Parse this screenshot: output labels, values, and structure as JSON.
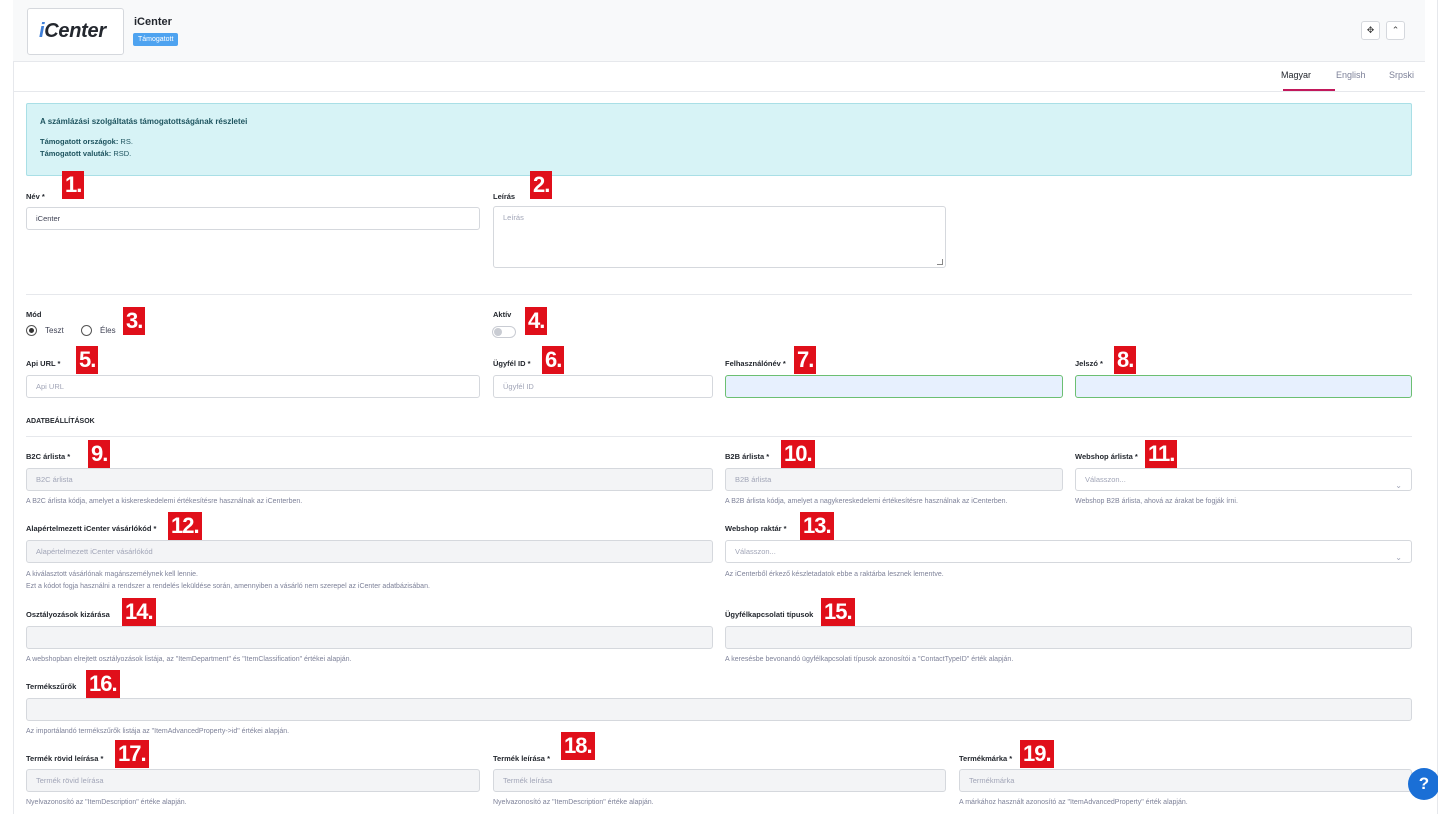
{
  "header": {
    "logo_prefix": "i",
    "logo_rest": "Center",
    "title": "iCenter",
    "badge": "Támogatott"
  },
  "header_buttons": {
    "expand_icon": "arrows-icon",
    "collapse_icon": "chevron-up-icon"
  },
  "tabs": [
    {
      "label": "Magyar",
      "active": true
    },
    {
      "label": "English"
    },
    {
      "label": "Srpski"
    }
  ],
  "info": {
    "title": "A számlázási szolgáltatás támogatottságának részletei",
    "countries_label": "Támogatott országok:",
    "countries_value": " RS.",
    "currencies_label": "Támogatott valuták:",
    "currencies_value": " RSD."
  },
  "fields": {
    "nev": {
      "label": "Név *",
      "value": "iCenter"
    },
    "leiras": {
      "label": "Leírás",
      "placeholder": "Leírás"
    },
    "mod": {
      "label": "Mód",
      "option1": "Teszt",
      "option2": "Éles",
      "selected": "Teszt"
    },
    "aktiv": {
      "label": "Aktív",
      "on": false
    },
    "api_url": {
      "label": "Api URL *",
      "placeholder": "Api URL"
    },
    "ugyfel_id": {
      "label": "Ügyfél ID *",
      "placeholder": "Ügyfél ID"
    },
    "felhasznalonev": {
      "label": "Felhasználónév *"
    },
    "jelszo": {
      "label": "Jelszó *"
    },
    "section": "ADATBEÁLLÍTÁSOK",
    "b2c": {
      "label": "B2C árlista *",
      "placeholder": "B2C árlista",
      "help": "A B2C árlista kódja, amelyet a kiskereskedelemi értékesítésre használnak az iCenterben."
    },
    "b2b": {
      "label": "B2B árlista *",
      "placeholder": "B2B árlista",
      "help": "A B2B árlista kódja, amelyet a nagykereskedelemi értékesítésre használnak az iCenterben."
    },
    "webshop_arlista": {
      "label": "Webshop árlista *",
      "placeholder": "Válasszon...",
      "help": "Webshop B2B árlista, ahová az árakat be fogják írni."
    },
    "alap_vasarlo": {
      "label": "Alapértelmezett iCenter vásárlókód *",
      "placeholder": "Alapértelmezett iCenter vásárlókód",
      "help1": "A kiválasztott vásárlónak magánszemélynek kell lennie.",
      "help2": "Ezt a kódot fogja használni a rendszer a rendelés leküldése során, amennyiben a vásárló nem szerepel az iCenter adatbázisában."
    },
    "webshop_raktar": {
      "label": "Webshop raktár *",
      "placeholder": "Válasszon...",
      "help": "Az iCenterből érkező készletadatok ebbe a raktárba lesznek lementve."
    },
    "osztalyozasok": {
      "label": "Osztályozások kizárása",
      "help": "A webshopban elrejtett osztályozások listája, az \"ItemDepartment\" és \"ItemClassification\" értékei alapján."
    },
    "ugyfelkapcsolati": {
      "label": "Ügyfélkapcsolati típusok",
      "help": "A keresésbe bevonandó ügyfélkapcsolati típusok azonosítói a \"ContactTypeID\" érték alapján."
    },
    "termekszurok": {
      "label": "Termékszűrők",
      "help": "Az importálandó termékszűrők listája az \"ItemAdvancedProperty->id\" értékei alapján."
    },
    "rovid_leiras": {
      "label": "Termék rövid leírása *",
      "placeholder": "Termék rövid leírása",
      "help": "Nyelvazonosító az \"ItemDescription\" értéke alapján."
    },
    "termek_leiras": {
      "label": "Termék leírása *",
      "placeholder": "Termék leírása",
      "help": "Nyelvazonosító az \"ItemDescription\" értéke alapján."
    },
    "termekmarka": {
      "label": "Termékmárka *",
      "placeholder": "Termékmárka",
      "help": "A márkához használt azonosító az \"ItemAdvancedProperty\" érték alapján."
    }
  },
  "markers": [
    "1.",
    "2.",
    "3.",
    "4.",
    "5.",
    "6.",
    "7.",
    "8.",
    "9.",
    "10.",
    "11.",
    "12.",
    "13.",
    "14.",
    "15.",
    "16.",
    "17.",
    "18.",
    "19."
  ],
  "help_fab": "?",
  "colors": {
    "accent": "#c2185b",
    "badge": "#4ea3f0",
    "marker": "#e00f1a",
    "info_bg": "#d7f3f6"
  }
}
